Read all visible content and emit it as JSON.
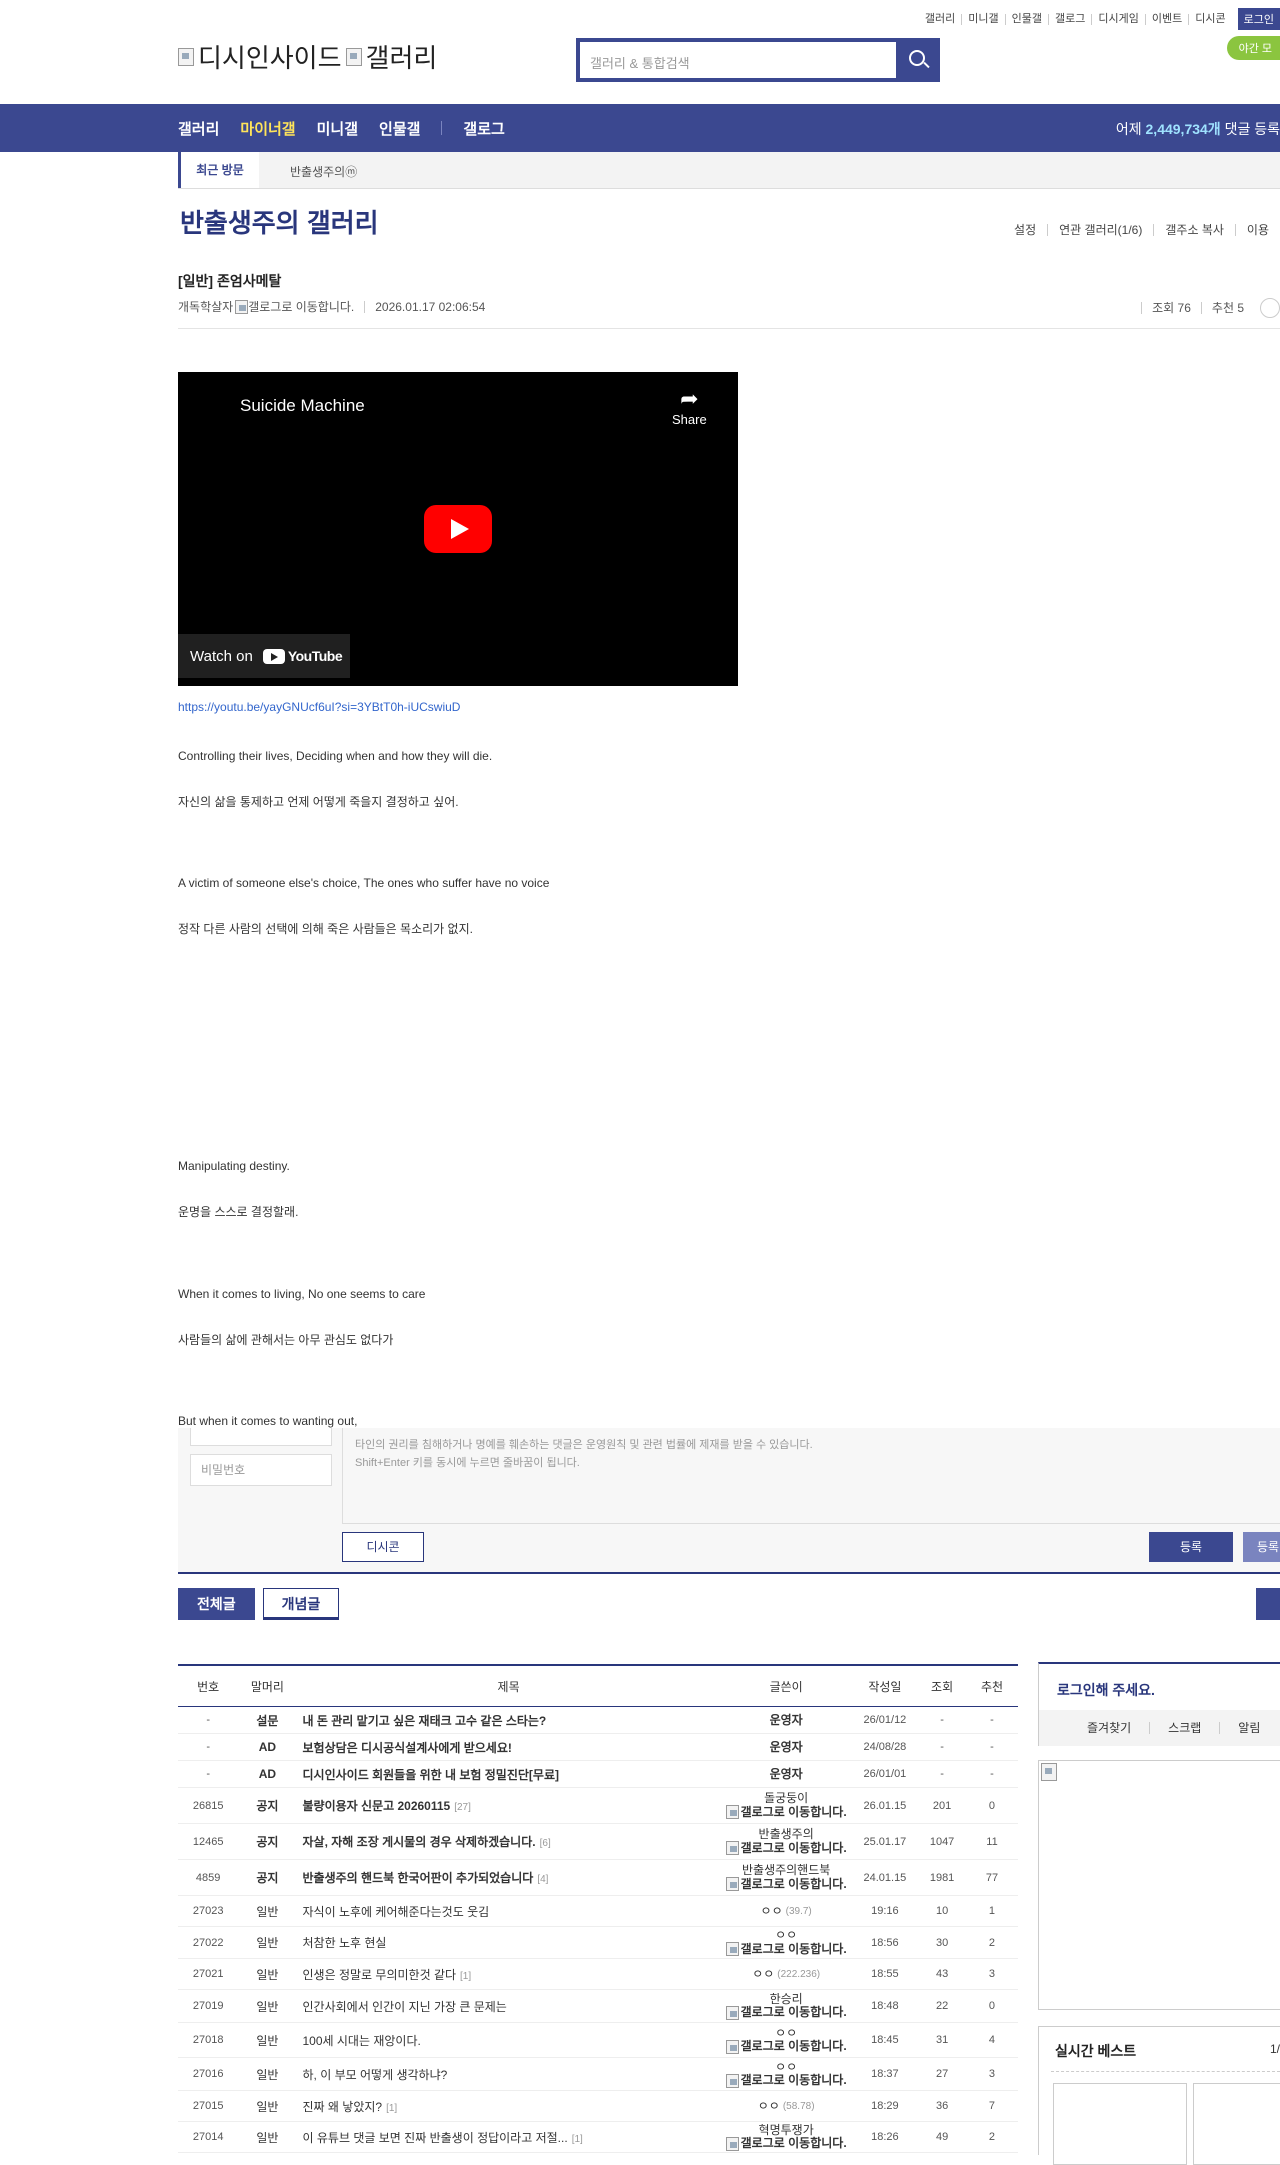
{
  "topbar": {
    "links": [
      "갤러리",
      "미니갤",
      "인물갤",
      "갤로그",
      "디시게임",
      "이벤트",
      "디시콘"
    ],
    "login": "로그인",
    "night_mode": "야간 모"
  },
  "logo": {
    "left": "디시인사이드",
    "right": "갤러리"
  },
  "search": {
    "placeholder": "갤러리 & 통합검색"
  },
  "gnb": {
    "items": [
      "갤러리",
      "마이너갤",
      "미니갤",
      "인물갤",
      "갤로그"
    ],
    "stat_prefix": "어제 ",
    "stat_value": "2,449,734개",
    "stat_suffix": " 댓글 등록"
  },
  "recent": {
    "label": "최근 방문",
    "gallery": "반출생주의ⓜ"
  },
  "gallery": {
    "title": "반출생주의 갤러리",
    "tools": [
      "설정",
      "연관 갤러리(1/6)",
      "갤주소 복사",
      "이용"
    ]
  },
  "post": {
    "title": "[일반] 존엄사메탈",
    "author": "개독학살자",
    "gallog_alt": "갤로그로 이동합니다.",
    "date": "2026.01.17 02:06:54",
    "views": "조회 76",
    "recommend": "추천 5"
  },
  "video": {
    "title": "Suicide Machine",
    "share": "Share",
    "watch_on": "Watch on",
    "youtube": "YouTube"
  },
  "body": [
    "https://youtu.be/yayGNUcf6uI?si=3YBtT0h-iUCswiuD",
    "Controlling their lives, Deciding when and how they will die.",
    "자신의 삶을 통제하고 언제 어떻게 죽을지 결정하고 싶어.",
    "A victim of someone else's choice, The ones who suffer have no voice",
    "정작 다른 사람의 선택에 의해 죽은 사람들은 목소리가 없지.",
    "Manipulating destiny.",
    "운명을 스스로 결정할래.",
    "When it comes to living, No one seems to care",
    "사람들의 삶에 관해서는 아무 관심도 없다가",
    "But when it comes to wanting out,"
  ],
  "comment": {
    "password_placeholder": "비밀번호",
    "notice1": "타인의 권리를 침해하거나 명예를 훼손하는 댓글은 운영원칙 및 관련 법률에 제재를 받을 수 있습니다.",
    "notice2": "Shift+Enter 키를 동시에 누르면 줄바꿈이 됩니다.",
    "dccon": "디시콘",
    "submit": "등록",
    "submit2": "등록"
  },
  "list_tabs": {
    "all": "전체글",
    "concept": "개념글"
  },
  "table": {
    "headers": [
      "번호",
      "말머리",
      "제목",
      "글쓴이",
      "작성일",
      "조회",
      "추천"
    ],
    "rows": [
      {
        "num": "-",
        "head": "설문",
        "title": "내 돈 관리 맡기고 싶은 재태크 고수 같은 스타는?",
        "cmt": "",
        "writer": "운영자",
        "ip": "",
        "gallog": false,
        "date": "26/01/12",
        "views": "-",
        "rec": "-",
        "bold": true
      },
      {
        "num": "-",
        "head": "AD",
        "title": "보험상담은 디시공식설계사에게 받으세요!",
        "cmt": "",
        "writer": "운영자",
        "ip": "",
        "gallog": false,
        "date": "24/08/28",
        "views": "-",
        "rec": "-",
        "bold": true
      },
      {
        "num": "-",
        "head": "AD",
        "title": "디시인사이드 회원들을 위한 내 보험 정밀진단[무료]",
        "cmt": "",
        "writer": "운영자",
        "ip": "",
        "gallog": false,
        "date": "26/01/01",
        "views": "-",
        "rec": "-",
        "bold": true
      },
      {
        "num": "26815",
        "head": "공지",
        "title": "불량이용자 신문고 20260115",
        "cmt": "[27]",
        "writer": "돌궁둥이",
        "ip": "",
        "gallog": true,
        "date": "26.01.15",
        "views": "201",
        "rec": "0",
        "bold": true
      },
      {
        "num": "12465",
        "head": "공지",
        "title": "자살, 자해 조장 게시물의 경우 삭제하겠습니다.",
        "cmt": "[6]",
        "writer": "반출생주의",
        "ip": "",
        "gallog": true,
        "date": "25.01.17",
        "views": "1047",
        "rec": "11",
        "bold": true
      },
      {
        "num": "4859",
        "head": "공지",
        "title": "반출생주의 핸드북 한국어판이 추가되었습니다",
        "cmt": "[4]",
        "writer": "반출생주의핸드북",
        "ip": "",
        "gallog": true,
        "date": "24.01.15",
        "views": "1981",
        "rec": "77",
        "bold": true
      },
      {
        "num": "27023",
        "head": "일반",
        "title": "자식이 노후에 케어해준다는것도 웃김",
        "cmt": "",
        "writer": "ㅇㅇ",
        "ip": "(39.7)",
        "gallog": false,
        "date": "19:16",
        "views": "10",
        "rec": "1",
        "bold": false
      },
      {
        "num": "27022",
        "head": "일반",
        "title": "처참한 노후 현실",
        "cmt": "",
        "writer": "ㅇㅇ",
        "ip": "",
        "gallog": true,
        "date": "18:56",
        "views": "30",
        "rec": "2",
        "bold": false
      },
      {
        "num": "27021",
        "head": "일반",
        "title": "인생은 정말로 무의미한것 같다",
        "cmt": "[1]",
        "writer": "ㅇㅇ",
        "ip": "(222.236)",
        "gallog": false,
        "date": "18:55",
        "views": "43",
        "rec": "3",
        "bold": false
      },
      {
        "num": "27019",
        "head": "일반",
        "title": "인간사회에서 인간이 지닌 가장 큰 문제는",
        "cmt": "",
        "writer": "한승리",
        "ip": "",
        "gallog": true,
        "date": "18:48",
        "views": "22",
        "rec": "0",
        "bold": false
      },
      {
        "num": "27018",
        "head": "일반",
        "title": "100세 시대는 재앙이다.",
        "cmt": "",
        "writer": "ㅇㅇ",
        "ip": "",
        "gallog": true,
        "date": "18:45",
        "views": "31",
        "rec": "4",
        "bold": false
      },
      {
        "num": "27016",
        "head": "일반",
        "title": "하, 이 부모 어떻게 생각하냐?",
        "cmt": "",
        "writer": "ㅇㅇ",
        "ip": "",
        "gallog": true,
        "date": "18:37",
        "views": "27",
        "rec": "3",
        "bold": false
      },
      {
        "num": "27015",
        "head": "일반",
        "title": "진짜 왜 낳았지?",
        "cmt": "[1]",
        "writer": "ㅇㅇ",
        "ip": "(58.78)",
        "gallog": false,
        "date": "18:29",
        "views": "36",
        "rec": "7",
        "bold": false
      },
      {
        "num": "27014",
        "head": "일반",
        "title": "이 유튜브 댓글 보면 진짜 반출생이 정답이라고 저절...",
        "cmt": "[1]",
        "writer": "혁명투쟁가",
        "ip": "",
        "gallog": true,
        "date": "18:26",
        "views": "49",
        "rec": "2",
        "bold": false
      }
    ]
  },
  "sidebar": {
    "login_prompt": "로그인해 주세요.",
    "links": [
      "즐겨찾기",
      "스크랩",
      "알림"
    ],
    "best_title": "실시간 베스트",
    "best_page": "1/"
  }
}
